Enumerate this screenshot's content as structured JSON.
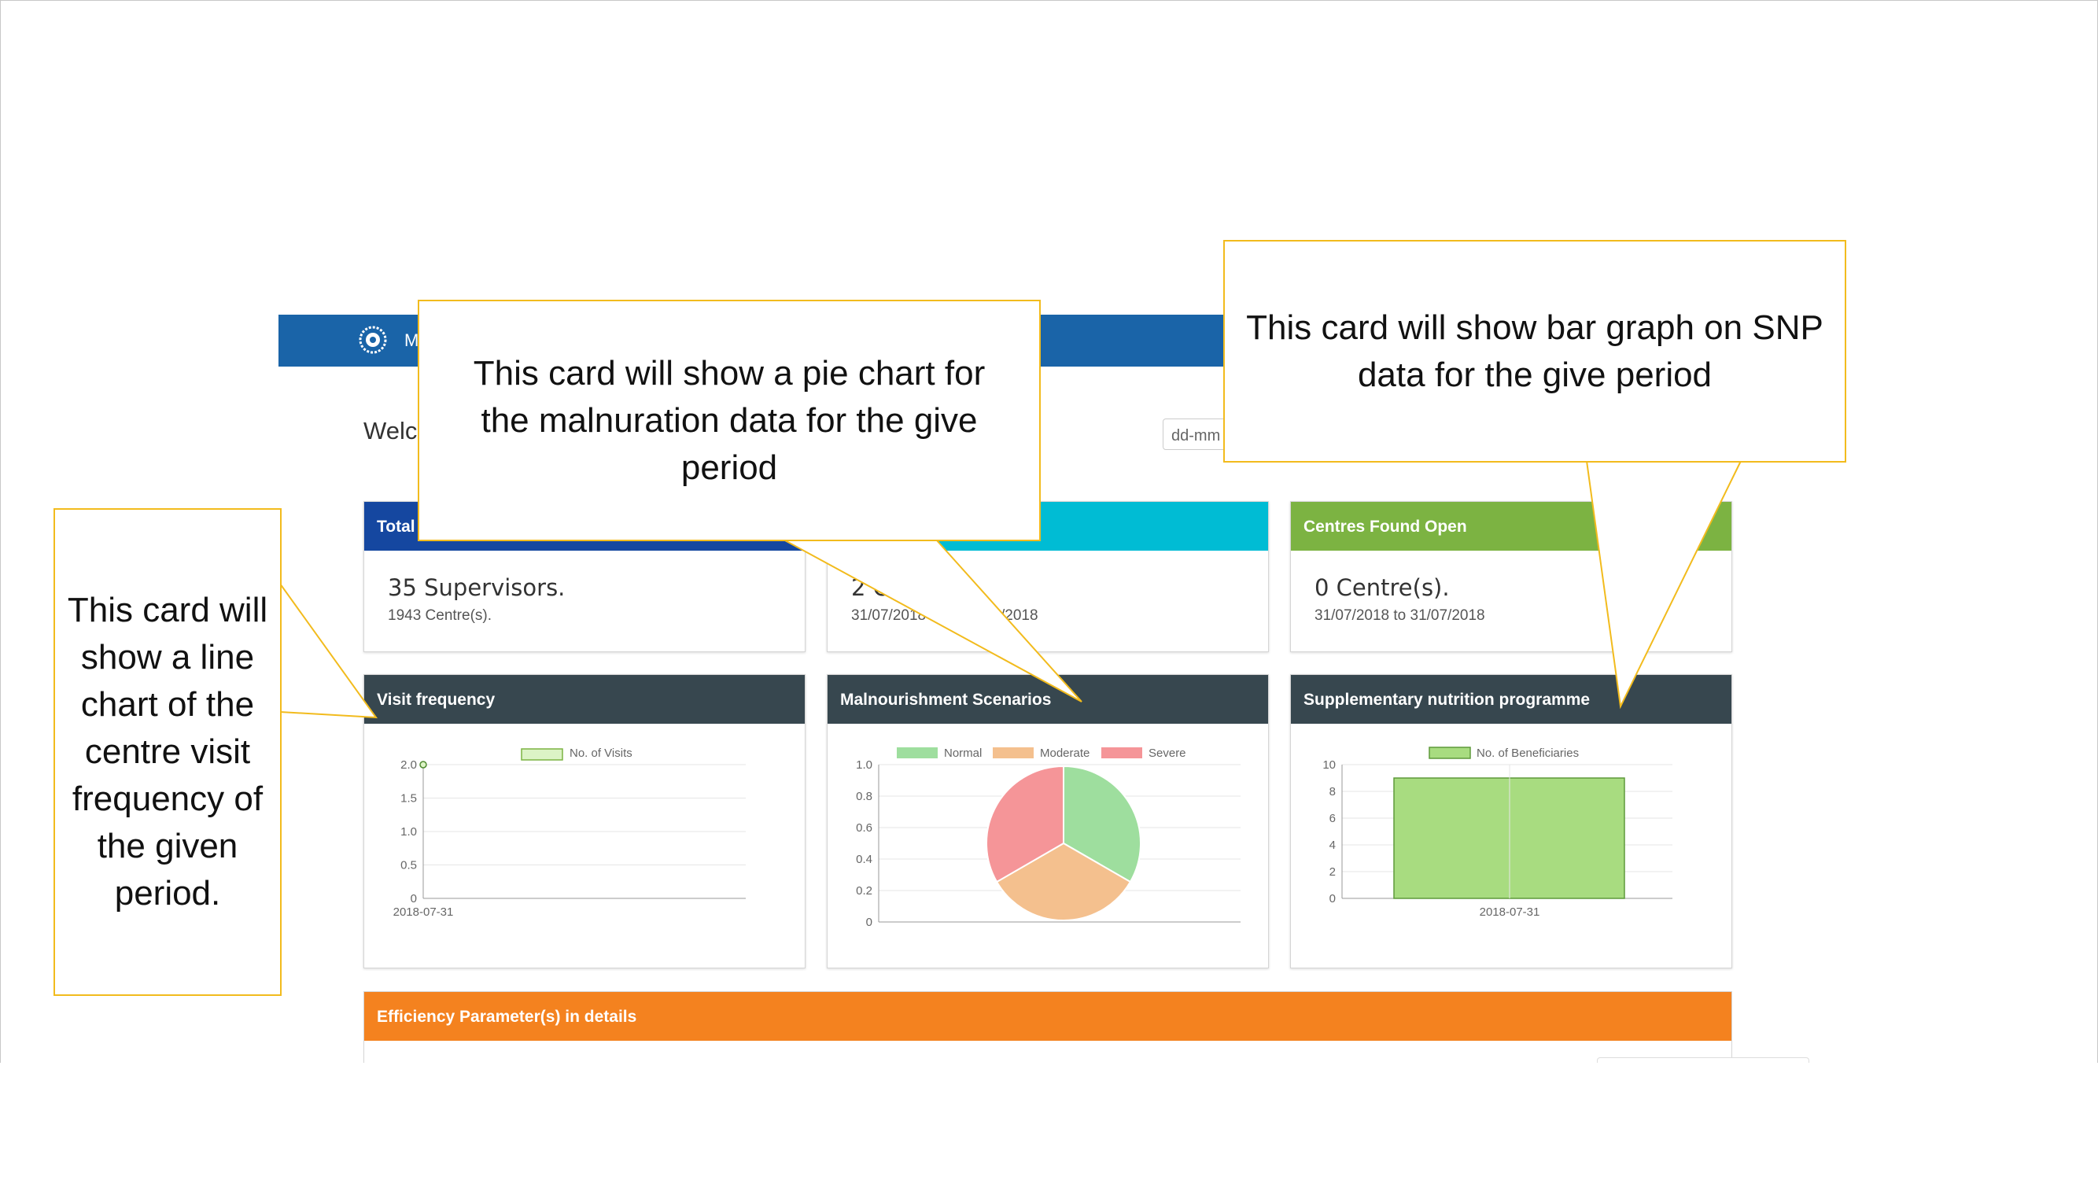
{
  "header": {
    "brand_partial": "M"
  },
  "welcome_partial": "Welc",
  "date_input_placeholder": "dd-mm",
  "stats": {
    "total": {
      "title": "Total",
      "main": "35 Supervisors.",
      "sub": "1943 Centre(s)."
    },
    "visited": {
      "main": "2 C",
      "sub_left": "31/07/2018",
      "sub_right": "/2018"
    },
    "open": {
      "title": "Centres Found Open",
      "main": "0 Centre(s).",
      "sub": "31/07/2018 to 31/07/2018"
    }
  },
  "cards": {
    "visit_frequency": "Visit frequency",
    "malnourishment": "Malnourishment Scenarios",
    "snp": "Supplementary nutrition programme",
    "efficiency": "Efficiency Parameter(s) in details"
  },
  "chart_data": [
    {
      "type": "line",
      "series": [
        {
          "name": "No. of Visits",
          "values": [
            2
          ]
        }
      ],
      "x": [
        "2018-07-31"
      ],
      "yticks": [
        "0",
        "0.5",
        "1.0",
        "1.5",
        "2.0"
      ],
      "ylim": [
        0,
        2
      ]
    },
    {
      "type": "pie",
      "categories": [
        "Normal",
        "Moderate",
        "Severe"
      ],
      "values": [
        1,
        1,
        1
      ],
      "colors": [
        "#9ede9e",
        "#f4c08e",
        "#f59598"
      ],
      "yticks": [
        "0",
        "0.2",
        "0.4",
        "0.6",
        "0.8",
        "1.0"
      ]
    },
    {
      "type": "bar",
      "series": [
        {
          "name": "No. of Beneficiaries",
          "values": [
            9
          ]
        }
      ],
      "categories": [
        "2018-07-31"
      ],
      "yticks": [
        "0",
        "2",
        "4",
        "6",
        "8",
        "10"
      ],
      "ylim": [
        0,
        10
      ]
    }
  ],
  "callouts": {
    "line": "This card will show a line chart of the centre visit frequency of the given period.",
    "pie": "This card will show a pie chart for the malnuration data for the give period",
    "bar": "This card will show bar graph on SNP data for the give period"
  },
  "colors": {
    "topbar": "#1a64a8",
    "total_header": "#1547a0",
    "visited_header": "#00bcd4",
    "open_header": "#7cb342",
    "chart_header": "#37474f",
    "efficiency_header": "#f4821f",
    "callout_border": "#f2bb1d"
  }
}
